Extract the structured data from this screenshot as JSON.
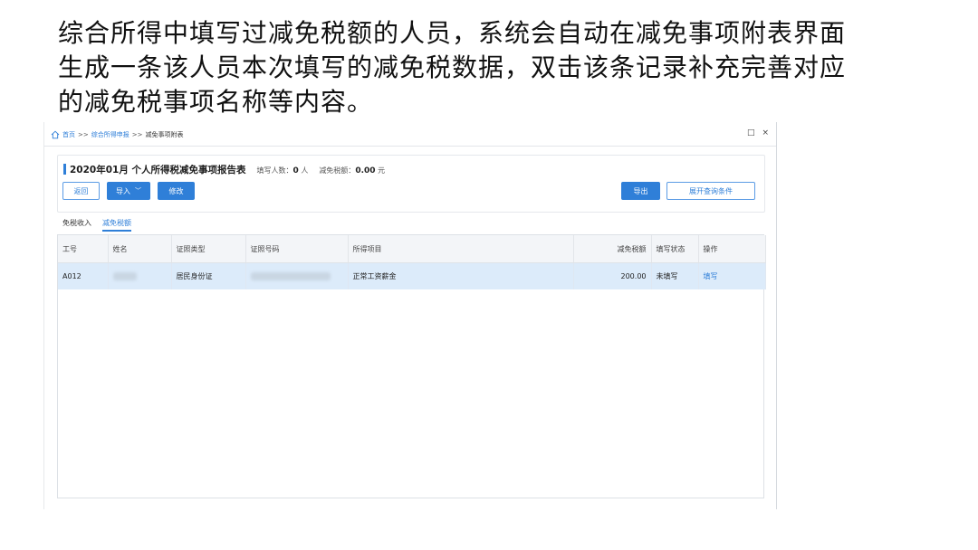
{
  "caption": {
    "line1": "综合所得中填写过减免税额的人员，系统会自动在减免事项附表界面",
    "line2": "生成一条该人员本次填写的减免税数据，双击该条记录补充完善对应",
    "line3": "的减免税事项名称等内容。"
  },
  "breadcrumb": {
    "home": "首页",
    "sep": ">>",
    "level2": "综合所得申报",
    "level3": "减免事项附表"
  },
  "window_controls": {
    "restore": "□",
    "close": "×"
  },
  "report": {
    "title": "2020年01月  个人所得税减免事项报告表",
    "count_label": "填写人数：",
    "count_value": "0",
    "count_unit": "人",
    "tax_label": "减免税额：",
    "tax_value": "0.00",
    "tax_unit": "元"
  },
  "toolbar": {
    "back_label": "返回",
    "import_label": "导入",
    "edit_label": "修改",
    "export_label": "导出",
    "expand_query_label": "展开查询条件"
  },
  "tabs": [
    {
      "label": "免税收入",
      "active": false
    },
    {
      "label": "减免税额",
      "active": true
    }
  ],
  "table": {
    "headers": [
      "工号",
      "姓名",
      "证照类型",
      "证照号码",
      "所得项目",
      "减免税额",
      "填写状态",
      "操作"
    ],
    "rows": [
      {
        "id": "A012",
        "name": "",
        "id_type": "居民身份证",
        "id_number": "",
        "income_item": "正常工资薪金",
        "amount": "200.00",
        "status": "未填写",
        "action": "填写"
      }
    ]
  },
  "colors": {
    "accent": "#2f7fd8",
    "selected_row": "#dcebfa"
  }
}
